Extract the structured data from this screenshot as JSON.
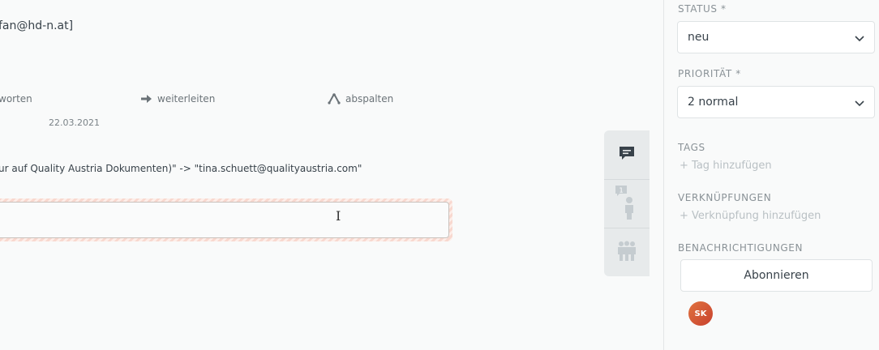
{
  "article": {
    "from_fragment": "fan@hd-n.at]",
    "actions": {
      "reply": "worten",
      "forward": "weiterleiten",
      "split": "abspalten"
    },
    "date": "22.03.2021",
    "body": "ur auf Quality Austria Dokumenten)\" -> \"tina.schuett@qualityaustria.com\""
  },
  "reply_field": {
    "value": ""
  },
  "tabs": [
    {
      "icon": "ticket-chat-icon"
    },
    {
      "icon": "customer-icon",
      "badge": "1"
    },
    {
      "icon": "organization-icon"
    }
  ],
  "sidebar": {
    "status": {
      "label": "STATUS *",
      "value": "neu"
    },
    "priority": {
      "label": "PRIORITÄT *",
      "value": "2 normal"
    },
    "tags": {
      "label": "TAGS",
      "add": "+ Tag hinzufügen"
    },
    "links": {
      "label": "VERKNÜPFUNGEN",
      "add": "+ Verknüpfung hinzufügen"
    },
    "notifications": {
      "label": "BENACHRICHTIGUNGEN",
      "subscribe": "Abonnieren"
    },
    "subscriber": {
      "initials": "SK"
    }
  },
  "colors": {
    "accent": "#e0733f",
    "tab_active": "#38424a",
    "tab_inactive": "#c5ccd0"
  }
}
